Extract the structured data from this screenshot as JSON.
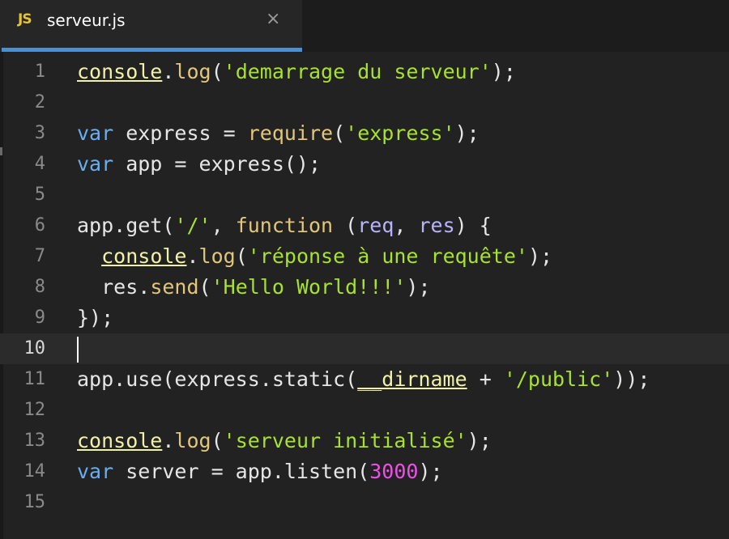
{
  "tab": {
    "badge": "JS",
    "title": "serveur.js",
    "close": "×"
  },
  "colors": {
    "background": "#222223",
    "tab_accent": "#4e8fd0",
    "keyword": "#6aaef0",
    "function": "#e2c679",
    "string": "#a6e22e",
    "number": "#f04ee8",
    "parameter": "#b7b3ff"
  },
  "editor": {
    "current_line": 10,
    "lines": [
      {
        "n": "1",
        "tokens": [
          [
            "obj",
            "console"
          ],
          [
            "p",
            "."
          ],
          [
            "fn",
            "log"
          ],
          [
            "p",
            "("
          ],
          [
            "str",
            "'demarrage du serveur'"
          ],
          [
            "p",
            ");"
          ]
        ]
      },
      {
        "n": "2",
        "tokens": []
      },
      {
        "n": "3",
        "tokens": [
          [
            "kw",
            "var"
          ],
          [
            "p",
            " express = "
          ],
          [
            "fn",
            "require"
          ],
          [
            "p",
            "("
          ],
          [
            "str",
            "'express'"
          ],
          [
            "p",
            ");"
          ]
        ]
      },
      {
        "n": "4",
        "tokens": [
          [
            "kw",
            "var"
          ],
          [
            "p",
            " app = express();"
          ]
        ]
      },
      {
        "n": "5",
        "tokens": []
      },
      {
        "n": "6",
        "tokens": [
          [
            "p",
            "app.get("
          ],
          [
            "str",
            "'/'"
          ],
          [
            "p",
            ", "
          ],
          [
            "fn",
            "function"
          ],
          [
            "p",
            " ("
          ],
          [
            "prm",
            "req"
          ],
          [
            "p",
            ", "
          ],
          [
            "prm",
            "res"
          ],
          [
            "p",
            ") {"
          ]
        ]
      },
      {
        "n": "7",
        "tokens": [
          [
            "p",
            "  "
          ],
          [
            "obj",
            "console"
          ],
          [
            "p",
            "."
          ],
          [
            "fn",
            "log"
          ],
          [
            "p",
            "("
          ],
          [
            "str",
            "'réponse à une requête'"
          ],
          [
            "p",
            ");"
          ]
        ]
      },
      {
        "n": "8",
        "tokens": [
          [
            "p",
            "  res."
          ],
          [
            "fn",
            "send"
          ],
          [
            "p",
            "("
          ],
          [
            "str",
            "'Hello World!!!'"
          ],
          [
            "p",
            ");"
          ]
        ]
      },
      {
        "n": "9",
        "tokens": [
          [
            "p",
            "});"
          ]
        ]
      },
      {
        "n": "10",
        "tokens": [
          [
            "cursor",
            ""
          ]
        ]
      },
      {
        "n": "11",
        "tokens": [
          [
            "p",
            "app.use(express.static("
          ],
          [
            "obj",
            "__dirname"
          ],
          [
            "p",
            " + "
          ],
          [
            "str",
            "'/public'"
          ],
          [
            "p",
            "));"
          ]
        ]
      },
      {
        "n": "12",
        "tokens": []
      },
      {
        "n": "13",
        "tokens": [
          [
            "obj",
            "console"
          ],
          [
            "p",
            "."
          ],
          [
            "fn",
            "log"
          ],
          [
            "p",
            "("
          ],
          [
            "str",
            "'serveur initialisé'"
          ],
          [
            "p",
            ");"
          ]
        ]
      },
      {
        "n": "14",
        "tokens": [
          [
            "kw",
            "var"
          ],
          [
            "p",
            " server = app.listen("
          ],
          [
            "num",
            "3000"
          ],
          [
            "p",
            ");"
          ]
        ]
      },
      {
        "n": "15",
        "tokens": []
      }
    ]
  }
}
